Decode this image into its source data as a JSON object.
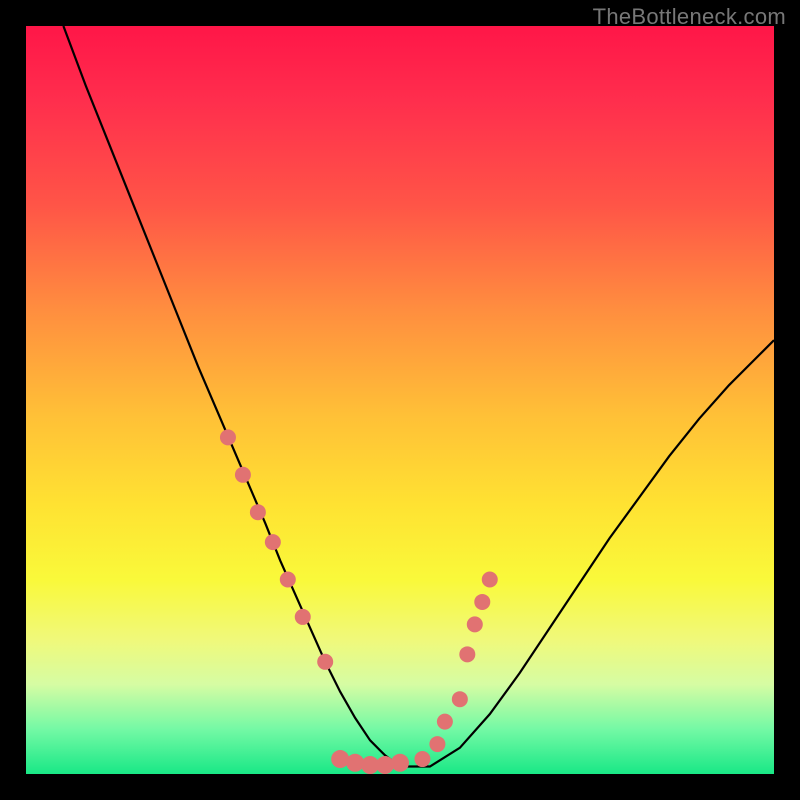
{
  "attribution": "TheBottleneck.com",
  "colors": {
    "bg": "#000000",
    "gradient_top": "#ff1648",
    "gradient_bottom": "#19e886",
    "curve": "#000000",
    "dots": "#e17272"
  },
  "chart_data": {
    "type": "line",
    "title": "",
    "xlabel": "",
    "ylabel": "",
    "xlim": [
      0,
      100
    ],
    "ylim": [
      0,
      100
    ],
    "curve": {
      "x": [
        5,
        8,
        11,
        14,
        17,
        20,
        23,
        26,
        29,
        32,
        34,
        36,
        38,
        40,
        42,
        44,
        46,
        48,
        50,
        54,
        58,
        62,
        66,
        70,
        74,
        78,
        82,
        86,
        90,
        94,
        98,
        100
      ],
      "y": [
        100,
        92,
        84.5,
        77,
        69.5,
        62,
        54.5,
        47.5,
        40.5,
        33.5,
        28.5,
        24,
        19.5,
        15,
        11,
        7.5,
        4.5,
        2.5,
        1,
        1,
        3.5,
        8,
        13.5,
        19.5,
        25.5,
        31.5,
        37,
        42.5,
        47.5,
        52,
        56,
        58
      ]
    },
    "dots_left": {
      "x": [
        27,
        29,
        31,
        33,
        35,
        37,
        40
      ],
      "y": [
        45,
        40,
        35,
        31,
        26,
        21,
        15
      ]
    },
    "dots_right": {
      "x": [
        53,
        55,
        56,
        58,
        59,
        60,
        61,
        62
      ],
      "y": [
        2,
        4,
        7,
        10,
        16,
        20,
        23,
        26
      ]
    },
    "dots_bottom": {
      "x": [
        42,
        44,
        46,
        48,
        50
      ],
      "y": [
        2,
        1.5,
        1.2,
        1.2,
        1.5
      ]
    }
  }
}
